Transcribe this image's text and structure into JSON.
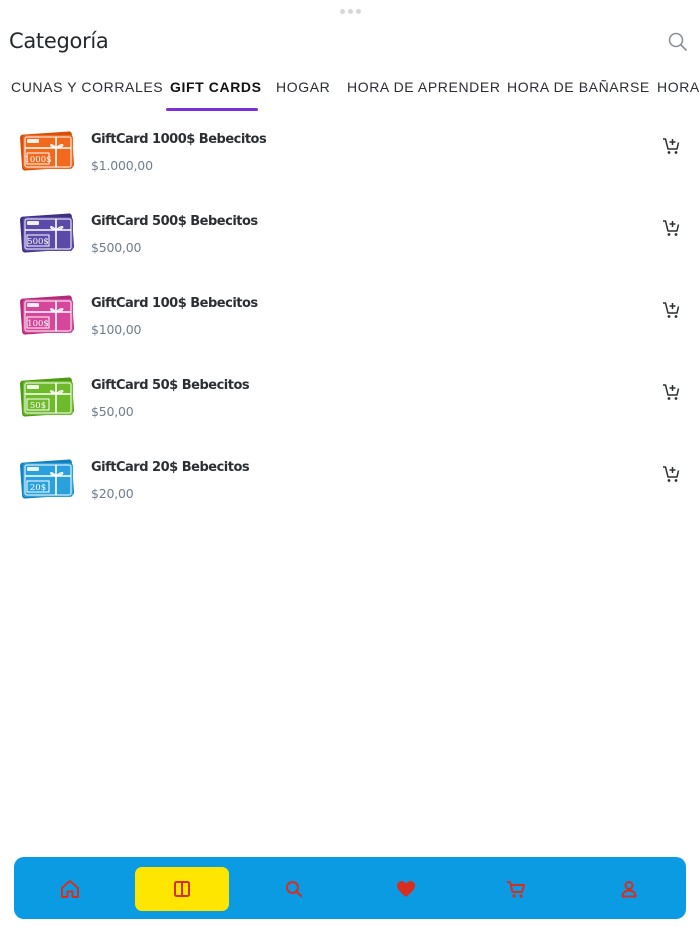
{
  "page": {
    "title": "Categoría"
  },
  "tabs": [
    {
      "label": "CUNAS Y CORRALES",
      "active": false
    },
    {
      "label": "GIFT CARDS",
      "active": true
    },
    {
      "label": "HOGAR",
      "active": false
    },
    {
      "label": "HORA DE APRENDER",
      "active": false
    },
    {
      "label": "HORA DE BAÑARSE",
      "active": false
    },
    {
      "label": "HORA",
      "active": false
    }
  ],
  "products": [
    {
      "name": "GiftCard 1000$ Bebecitos",
      "price": "$1.000,00",
      "card_label": "1000$",
      "card_color": "#f2681d",
      "card_color_dark": "#d4500b",
      "icon": "cart-plus-icon"
    },
    {
      "name": "GiftCard 500$ Bebecitos",
      "price": "$500,00",
      "card_label": "500$",
      "card_color": "#5b4aa8",
      "card_color_dark": "#3f3180",
      "icon": "cart-plus-icon"
    },
    {
      "name": "GiftCard 100$ Bebecitos",
      "price": "$100,00",
      "card_label": "100$",
      "card_color": "#d6479b",
      "card_color_dark": "#b02d7a",
      "icon": "cart-plus-icon"
    },
    {
      "name": "GiftCard 50$ Bebecitos",
      "price": "$50,00",
      "card_label": "50$",
      "card_color": "#6dbb2b",
      "card_color_dark": "#4f9a16",
      "icon": "cart-plus-icon"
    },
    {
      "name": "GiftCard 20$ Bebecitos",
      "price": "$20,00",
      "card_label": "20$",
      "card_color": "#2aa0dc",
      "card_color_dark": "#1680ba",
      "icon": "cart-plus-icon"
    }
  ],
  "bottom_nav": {
    "background": "#0b9be3",
    "active_background": "#ffe600",
    "icon_color": "#d62f1f",
    "items": [
      {
        "icon": "home-icon",
        "active": false
      },
      {
        "icon": "categories-icon",
        "active": true
      },
      {
        "icon": "search-icon",
        "active": false
      },
      {
        "icon": "heart-icon",
        "active": false
      },
      {
        "icon": "cart-icon",
        "active": false
      },
      {
        "icon": "user-icon",
        "active": false
      }
    ]
  },
  "colors": {
    "tab_indicator": "#7b2fd6",
    "price_text": "#6f7e8d"
  }
}
